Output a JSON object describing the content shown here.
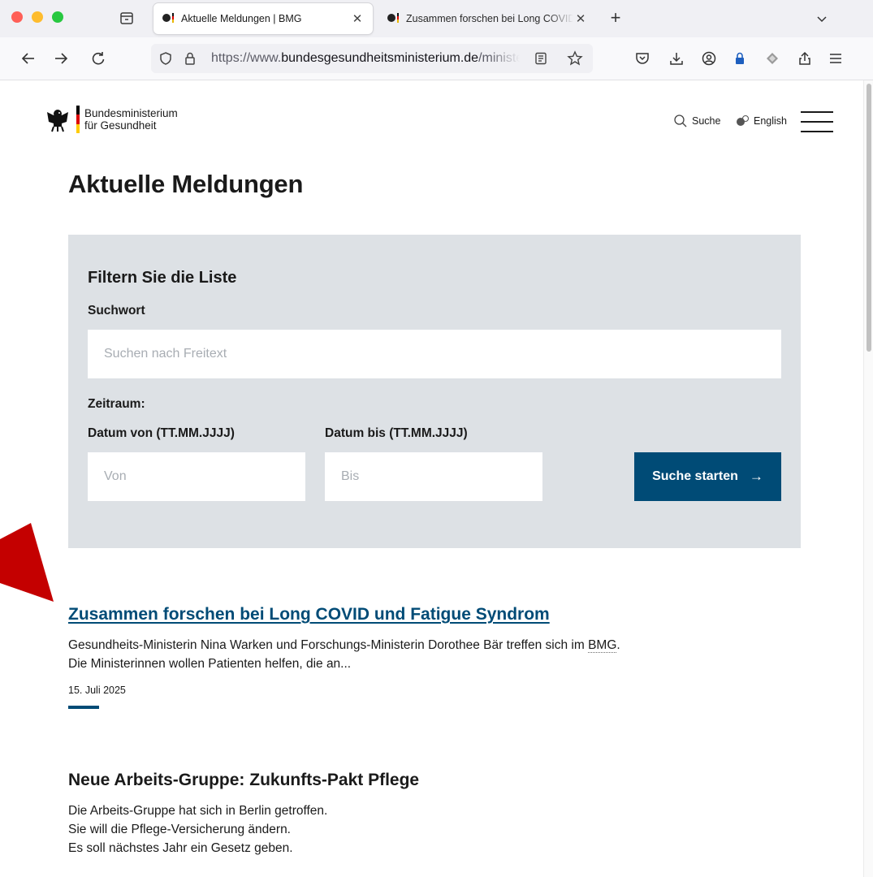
{
  "browser": {
    "tabs": [
      {
        "title": "Aktuelle Meldungen | BMG",
        "active": true
      },
      {
        "title": "Zusammen forschen bei Long COVID und Fatigue Syndrom",
        "active": false
      }
    ],
    "url_prefix": "https://www.",
    "url_host": "bundesgesundheitsministerium.de",
    "url_rest": "/ministerium/leichte-sprache/meldungen"
  },
  "site": {
    "logo_line1": "Bundesministerium",
    "logo_line2": "für Gesundheit",
    "search_label": "Suche",
    "language_label": "English",
    "colors": {
      "primary": "#004b76",
      "filter_bg": "#dde1e5"
    }
  },
  "page": {
    "title": "Aktuelle Meldungen"
  },
  "filter": {
    "heading": "Filtern Sie die Liste",
    "keyword_label": "Suchwort",
    "keyword_placeholder": "Suchen nach Freitext",
    "period_label": "Zeitraum:",
    "date_from_label": "Datum von (TT.MM.JJJJ)",
    "date_to_label": "Datum bis (TT.MM.JJJJ)",
    "date_from_placeholder": "Von",
    "date_to_placeholder": "Bis",
    "submit_label": "Suche starten",
    "submit_arrow": "→"
  },
  "articles": [
    {
      "title": "Zusammen forschen bei Long COVID und Fatigue Syndrom",
      "teaser_line1_pre": "Gesundheits-Ministerin Nina Warken und Forschungs-Ministerin Dorothee Bär treffen sich im ",
      "teaser_line1_abbr": "BMG",
      "teaser_line1_post": ".",
      "teaser_line2": "Die Ministerinnen wollen Patienten helfen, die an...",
      "date": "15. Juli 2025"
    },
    {
      "title": "Neue Arbeits-Gruppe: Zukunfts-Pakt Pflege",
      "teaser_line1": "Die Arbeits-Gruppe hat sich in Berlin getroffen.",
      "teaser_line2": "Sie will die Pflege-Versicherung ändern.",
      "teaser_line3": "Es soll nächstes Jahr ein Gesetz geben."
    }
  ]
}
